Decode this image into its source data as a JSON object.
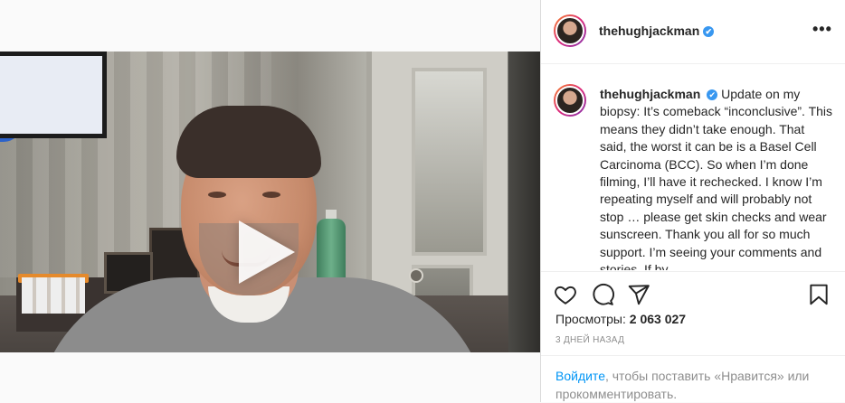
{
  "post": {
    "username": "thehughjackman",
    "verified_symbol": "✔",
    "more_icon": "more-options-icon",
    "caption_text": "Update on my biopsy: It’s comeback “inconclusive”. This means they didn’t take enough. That said, the worst it can be is a Basel Cell Carcinoma (BCC). So when I’m done filming, I’ll have it rechecked. I know I’m repeating myself and will probably not stop … please get skin checks and wear sunscreen. Thank you all for so much support. I’m seeing your comments and stories. If by",
    "views_label": "Просмотры:",
    "views_count": "2 063 027",
    "date": "3 ДНЕЙ НАЗАД"
  },
  "login_prompt": {
    "link_text": "Войдите",
    "rest_text": ", чтобы поставить «Нравится» или прокомментировать."
  },
  "icons": [
    "heart-icon",
    "comment-icon",
    "share-icon",
    "bookmark-icon",
    "play-icon"
  ],
  "colors": {
    "link": "#0095f6",
    "verified": "#3897f0",
    "muted": "#8e8e8e",
    "text": "#262626"
  }
}
